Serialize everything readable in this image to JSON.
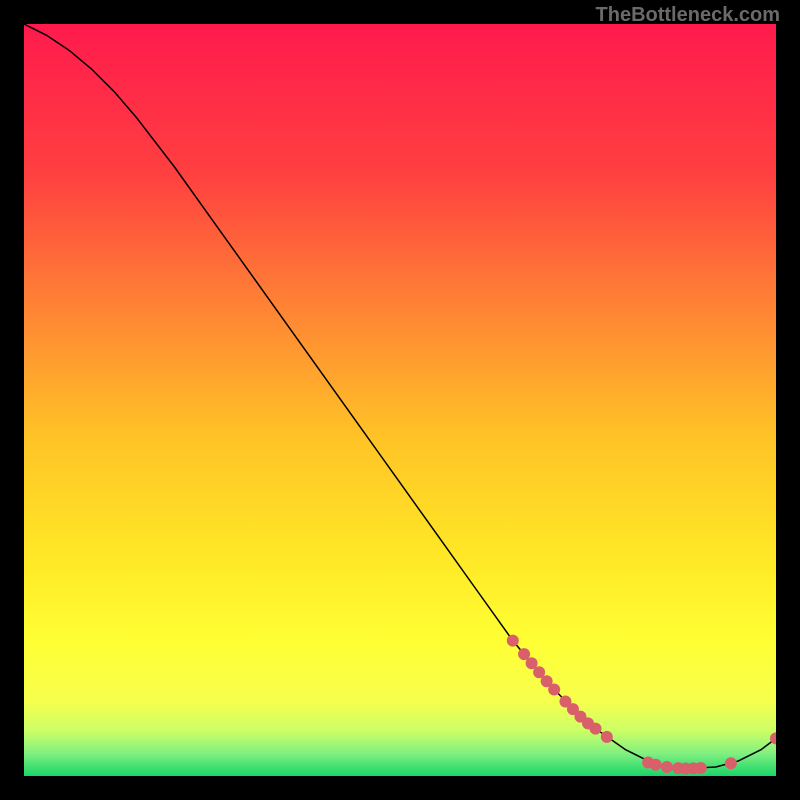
{
  "watermark": "TheBottleneck.com",
  "chart_data": {
    "type": "line",
    "title": "",
    "xlabel": "",
    "ylabel": "",
    "xlim": [
      0,
      100
    ],
    "ylim": [
      0,
      100
    ],
    "grid": false,
    "legend": false,
    "gradient_stops": [
      {
        "offset": 0,
        "color": "#ff1a4d"
      },
      {
        "offset": 20,
        "color": "#ff4040"
      },
      {
        "offset": 40,
        "color": "#ff8c33"
      },
      {
        "offset": 55,
        "color": "#ffc326"
      },
      {
        "offset": 70,
        "color": "#ffe626"
      },
      {
        "offset": 82,
        "color": "#ffff33"
      },
      {
        "offset": 90,
        "color": "#f7ff4d"
      },
      {
        "offset": 94,
        "color": "#ccff66"
      },
      {
        "offset": 97,
        "color": "#80f080"
      },
      {
        "offset": 100,
        "color": "#1ad46a"
      }
    ],
    "curve": [
      {
        "x": 0,
        "y": 100
      },
      {
        "x": 3,
        "y": 98.5
      },
      {
        "x": 6,
        "y": 96.5
      },
      {
        "x": 9,
        "y": 94
      },
      {
        "x": 12,
        "y": 91
      },
      {
        "x": 15,
        "y": 87.5
      },
      {
        "x": 20,
        "y": 81
      },
      {
        "x": 25,
        "y": 74
      },
      {
        "x": 30,
        "y": 67
      },
      {
        "x": 35,
        "y": 60
      },
      {
        "x": 40,
        "y": 53
      },
      {
        "x": 45,
        "y": 46
      },
      {
        "x": 50,
        "y": 39
      },
      {
        "x": 55,
        "y": 32
      },
      {
        "x": 60,
        "y": 25
      },
      {
        "x": 65,
        "y": 18
      },
      {
        "x": 70,
        "y": 12
      },
      {
        "x": 75,
        "y": 7
      },
      {
        "x": 80,
        "y": 3.5
      },
      {
        "x": 84,
        "y": 1.5
      },
      {
        "x": 88,
        "y": 1
      },
      {
        "x": 92,
        "y": 1.2
      },
      {
        "x": 95,
        "y": 2
      },
      {
        "x": 98,
        "y": 3.5
      },
      {
        "x": 100,
        "y": 5
      }
    ],
    "markers": [
      {
        "x": 65.0,
        "y": 18.0
      },
      {
        "x": 66.5,
        "y": 16.2
      },
      {
        "x": 67.5,
        "y": 15.0
      },
      {
        "x": 68.5,
        "y": 13.8
      },
      {
        "x": 69.5,
        "y": 12.6
      },
      {
        "x": 70.5,
        "y": 11.5
      },
      {
        "x": 72.0,
        "y": 9.9
      },
      {
        "x": 73.0,
        "y": 8.9
      },
      {
        "x": 74.0,
        "y": 7.9
      },
      {
        "x": 75.0,
        "y": 7.0
      },
      {
        "x": 76.0,
        "y": 6.3
      },
      {
        "x": 77.5,
        "y": 5.2
      },
      {
        "x": 83.0,
        "y": 1.8
      },
      {
        "x": 84.0,
        "y": 1.5
      },
      {
        "x": 85.5,
        "y": 1.2
      },
      {
        "x": 87.0,
        "y": 1.05
      },
      {
        "x": 88.0,
        "y": 1.0
      },
      {
        "x": 89.0,
        "y": 1.02
      },
      {
        "x": 90.0,
        "y": 1.07
      },
      {
        "x": 94.0,
        "y": 1.7
      },
      {
        "x": 100.0,
        "y": 5.0
      }
    ],
    "marker_color": "#d9606a",
    "marker_radius": 6,
    "line_color": "#000000"
  }
}
